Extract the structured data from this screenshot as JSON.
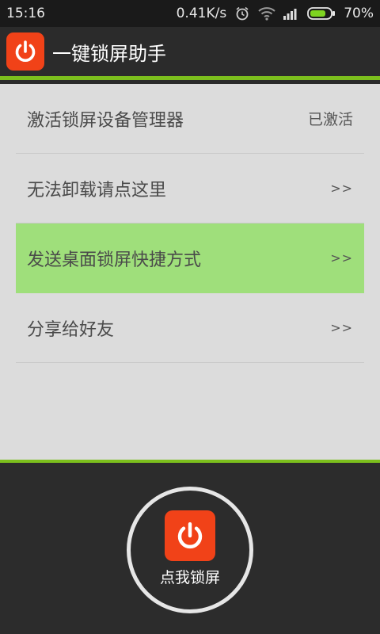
{
  "status_bar": {
    "time": "15:16",
    "net_speed": "0.41K/s",
    "battery": "70%",
    "icons": [
      "alarm-icon",
      "wifi-icon",
      "signal-icon",
      "battery-icon"
    ]
  },
  "app_bar": {
    "title": "一键锁屏助手",
    "logo_icon": "power-icon",
    "accent": "#7cbf1d",
    "logo_color": "#f14218"
  },
  "menu": {
    "items": [
      {
        "label": "激活锁屏设备管理器",
        "value": "已激活"
      },
      {
        "label": "无法卸载请点这里",
        "value": ">>"
      },
      {
        "label": "发送桌面锁屏快捷方式",
        "value": ">>"
      },
      {
        "label": "分享给好友",
        "value": ">>"
      }
    ],
    "highlight_color": "#9fdf7b"
  },
  "lock_button": {
    "label": "点我锁屏",
    "icon": "power-icon"
  }
}
